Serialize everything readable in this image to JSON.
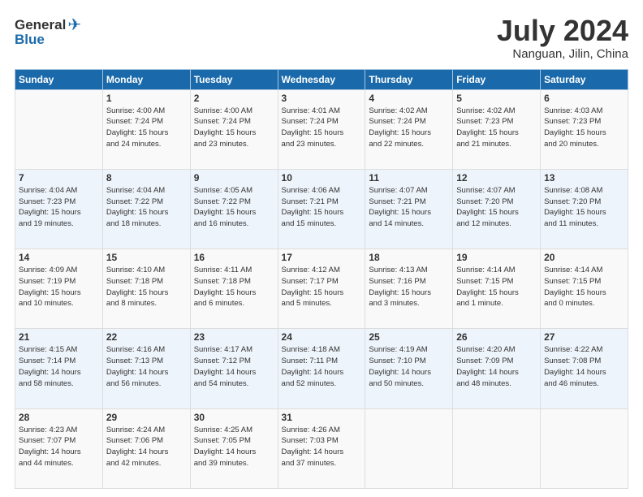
{
  "header": {
    "logo_general": "General",
    "logo_blue": "Blue",
    "title": "July 2024",
    "subtitle": "Nanguan, Jilin, China"
  },
  "columns": [
    "Sunday",
    "Monday",
    "Tuesday",
    "Wednesday",
    "Thursday",
    "Friday",
    "Saturday"
  ],
  "weeks": [
    [
      {
        "day": "",
        "info": ""
      },
      {
        "day": "1",
        "info": "Sunrise: 4:00 AM\nSunset: 7:24 PM\nDaylight: 15 hours\nand 24 minutes."
      },
      {
        "day": "2",
        "info": "Sunrise: 4:00 AM\nSunset: 7:24 PM\nDaylight: 15 hours\nand 23 minutes."
      },
      {
        "day": "3",
        "info": "Sunrise: 4:01 AM\nSunset: 7:24 PM\nDaylight: 15 hours\nand 23 minutes."
      },
      {
        "day": "4",
        "info": "Sunrise: 4:02 AM\nSunset: 7:24 PM\nDaylight: 15 hours\nand 22 minutes."
      },
      {
        "day": "5",
        "info": "Sunrise: 4:02 AM\nSunset: 7:23 PM\nDaylight: 15 hours\nand 21 minutes."
      },
      {
        "day": "6",
        "info": "Sunrise: 4:03 AM\nSunset: 7:23 PM\nDaylight: 15 hours\nand 20 minutes."
      }
    ],
    [
      {
        "day": "7",
        "info": "Sunrise: 4:04 AM\nSunset: 7:23 PM\nDaylight: 15 hours\nand 19 minutes."
      },
      {
        "day": "8",
        "info": "Sunrise: 4:04 AM\nSunset: 7:22 PM\nDaylight: 15 hours\nand 18 minutes."
      },
      {
        "day": "9",
        "info": "Sunrise: 4:05 AM\nSunset: 7:22 PM\nDaylight: 15 hours\nand 16 minutes."
      },
      {
        "day": "10",
        "info": "Sunrise: 4:06 AM\nSunset: 7:21 PM\nDaylight: 15 hours\nand 15 minutes."
      },
      {
        "day": "11",
        "info": "Sunrise: 4:07 AM\nSunset: 7:21 PM\nDaylight: 15 hours\nand 14 minutes."
      },
      {
        "day": "12",
        "info": "Sunrise: 4:07 AM\nSunset: 7:20 PM\nDaylight: 15 hours\nand 12 minutes."
      },
      {
        "day": "13",
        "info": "Sunrise: 4:08 AM\nSunset: 7:20 PM\nDaylight: 15 hours\nand 11 minutes."
      }
    ],
    [
      {
        "day": "14",
        "info": "Sunrise: 4:09 AM\nSunset: 7:19 PM\nDaylight: 15 hours\nand 10 minutes."
      },
      {
        "day": "15",
        "info": "Sunrise: 4:10 AM\nSunset: 7:18 PM\nDaylight: 15 hours\nand 8 minutes."
      },
      {
        "day": "16",
        "info": "Sunrise: 4:11 AM\nSunset: 7:18 PM\nDaylight: 15 hours\nand 6 minutes."
      },
      {
        "day": "17",
        "info": "Sunrise: 4:12 AM\nSunset: 7:17 PM\nDaylight: 15 hours\nand 5 minutes."
      },
      {
        "day": "18",
        "info": "Sunrise: 4:13 AM\nSunset: 7:16 PM\nDaylight: 15 hours\nand 3 minutes."
      },
      {
        "day": "19",
        "info": "Sunrise: 4:14 AM\nSunset: 7:15 PM\nDaylight: 15 hours\nand 1 minute."
      },
      {
        "day": "20",
        "info": "Sunrise: 4:14 AM\nSunset: 7:15 PM\nDaylight: 15 hours\nand 0 minutes."
      }
    ],
    [
      {
        "day": "21",
        "info": "Sunrise: 4:15 AM\nSunset: 7:14 PM\nDaylight: 14 hours\nand 58 minutes."
      },
      {
        "day": "22",
        "info": "Sunrise: 4:16 AM\nSunset: 7:13 PM\nDaylight: 14 hours\nand 56 minutes."
      },
      {
        "day": "23",
        "info": "Sunrise: 4:17 AM\nSunset: 7:12 PM\nDaylight: 14 hours\nand 54 minutes."
      },
      {
        "day": "24",
        "info": "Sunrise: 4:18 AM\nSunset: 7:11 PM\nDaylight: 14 hours\nand 52 minutes."
      },
      {
        "day": "25",
        "info": "Sunrise: 4:19 AM\nSunset: 7:10 PM\nDaylight: 14 hours\nand 50 minutes."
      },
      {
        "day": "26",
        "info": "Sunrise: 4:20 AM\nSunset: 7:09 PM\nDaylight: 14 hours\nand 48 minutes."
      },
      {
        "day": "27",
        "info": "Sunrise: 4:22 AM\nSunset: 7:08 PM\nDaylight: 14 hours\nand 46 minutes."
      }
    ],
    [
      {
        "day": "28",
        "info": "Sunrise: 4:23 AM\nSunset: 7:07 PM\nDaylight: 14 hours\nand 44 minutes."
      },
      {
        "day": "29",
        "info": "Sunrise: 4:24 AM\nSunset: 7:06 PM\nDaylight: 14 hours\nand 42 minutes."
      },
      {
        "day": "30",
        "info": "Sunrise: 4:25 AM\nSunset: 7:05 PM\nDaylight: 14 hours\nand 39 minutes."
      },
      {
        "day": "31",
        "info": "Sunrise: 4:26 AM\nSunset: 7:03 PM\nDaylight: 14 hours\nand 37 minutes."
      },
      {
        "day": "",
        "info": ""
      },
      {
        "day": "",
        "info": ""
      },
      {
        "day": "",
        "info": ""
      }
    ]
  ]
}
